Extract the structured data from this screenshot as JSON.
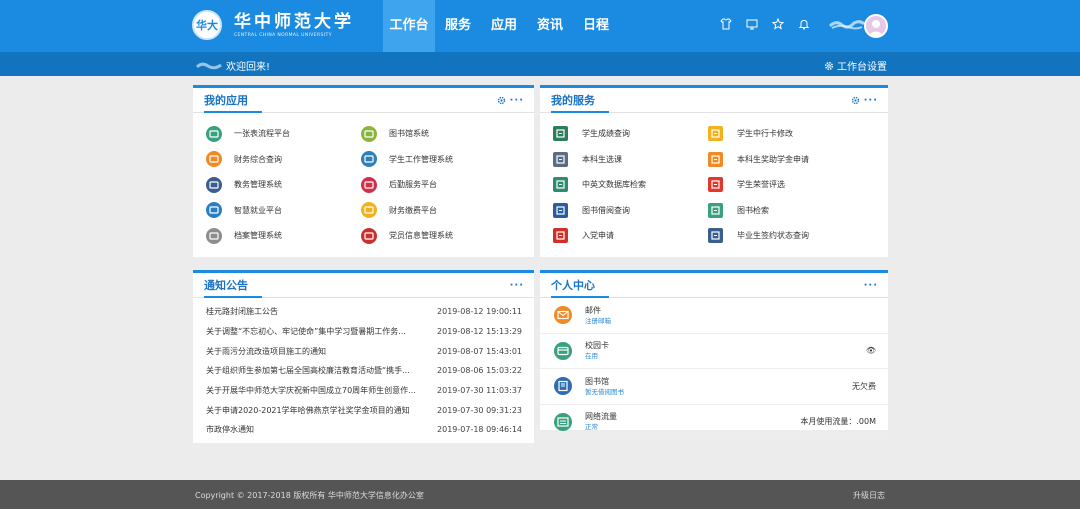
{
  "header": {
    "university_name_cn": "华中师范大学",
    "university_name_en": "CENTRAL CHINA NORMAL UNIVERSITY",
    "seal_text": "华大",
    "nav": [
      {
        "label": "工作台",
        "active": true
      },
      {
        "label": "服务",
        "active": false
      },
      {
        "label": "应用",
        "active": false
      },
      {
        "label": "资讯",
        "active": false
      },
      {
        "label": "日程",
        "active": false
      }
    ],
    "icons": [
      "shirt-icon",
      "monitor-icon",
      "star-icon",
      "bell-icon"
    ]
  },
  "subbar": {
    "welcome": "欢迎回来!",
    "settings_label": "工作台设置"
  },
  "my_apps": {
    "title": "我的应用",
    "items": [
      {
        "label": "一张表流程平台",
        "color": "#3aa17e"
      },
      {
        "label": "图书馆系统",
        "color": "#8bb43f"
      },
      {
        "label": "财务综合查询",
        "color": "#f08a24"
      },
      {
        "label": "学生工作管理系统",
        "color": "#2f7fb8"
      },
      {
        "label": "教务管理系统",
        "color": "#3b5d8f"
      },
      {
        "label": "后勤服务平台",
        "color": "#d0304a"
      },
      {
        "label": "智慧就业平台",
        "color": "#2a7fc4"
      },
      {
        "label": "财务缴费平台",
        "color": "#f2b21c"
      },
      {
        "label": "档案管理系统",
        "color": "#8d8d8d"
      },
      {
        "label": "党员信息管理系统",
        "color": "#c9302c"
      }
    ]
  },
  "my_services": {
    "title": "我的服务",
    "items": [
      {
        "label": "学生成绩查询",
        "color": "#2e7d5b"
      },
      {
        "label": "学生中行卡修改",
        "color": "#f2b21c"
      },
      {
        "label": "本科生选课",
        "color": "#5a6d86"
      },
      {
        "label": "本科生奖助学金申请",
        "color": "#f08a24"
      },
      {
        "label": "中英文数据库检索",
        "color": "#2e8d6e"
      },
      {
        "label": "学生荣誉评选",
        "color": "#e0382c"
      },
      {
        "label": "图书借阅查询",
        "color": "#2a5d9f"
      },
      {
        "label": "图书检索",
        "color": "#3aa17e"
      },
      {
        "label": "入党申请",
        "color": "#d0302a"
      },
      {
        "label": "毕业生签约状态查询",
        "color": "#3b5d8f"
      }
    ]
  },
  "notices": {
    "title": "通知公告",
    "items": [
      {
        "title": "桂元路封闭施工公告",
        "time": "2019-08-12 19:00:11"
      },
      {
        "title": "关于调整“不忘初心、牢记使命”集中学习暨暑期工作务...",
        "time": "2019-08-12 15:13:29"
      },
      {
        "title": "关于雨污分流改造项目施工的通知",
        "time": "2019-08-07 15:43:01"
      },
      {
        "title": "关于组织师生参加第七届全国高校廉洁教育活动暨“携手...",
        "time": "2019-08-06 15:03:22"
      },
      {
        "title": "关于开展华中师范大学庆祝新中国成立70周年师生创意作...",
        "time": "2019-07-30 11:03:37"
      },
      {
        "title": "关于申请2020-2021学年哈佛燕京学社奖学金项目的通知",
        "time": "2019-07-30 09:31:23"
      },
      {
        "title": "市政停水通知",
        "time": "2019-07-18 09:46:14"
      }
    ]
  },
  "personal": {
    "title": "个人中心",
    "items": [
      {
        "name": "邮件",
        "sub": "注册邮箱",
        "right": "",
        "color": "#f08a24",
        "icon": "mail-icon"
      },
      {
        "name": "校园卡",
        "sub": "在用",
        "right": "👁",
        "color": "#3aa17e",
        "icon": "card-icon"
      },
      {
        "name": "图书馆",
        "sub": "暂无借阅图书",
        "right": "无欠费",
        "color": "#2f6db0",
        "icon": "book-icon"
      },
      {
        "name": "网络流量",
        "sub": "正常",
        "right": "本月使用流量：.00M",
        "color": "#3aa17e",
        "icon": "network-icon"
      }
    ]
  },
  "footer": {
    "copyright": "Copyright © 2017-2018 版权所有 华中师范大学信息化办公室",
    "changelog": "升级日志"
  }
}
